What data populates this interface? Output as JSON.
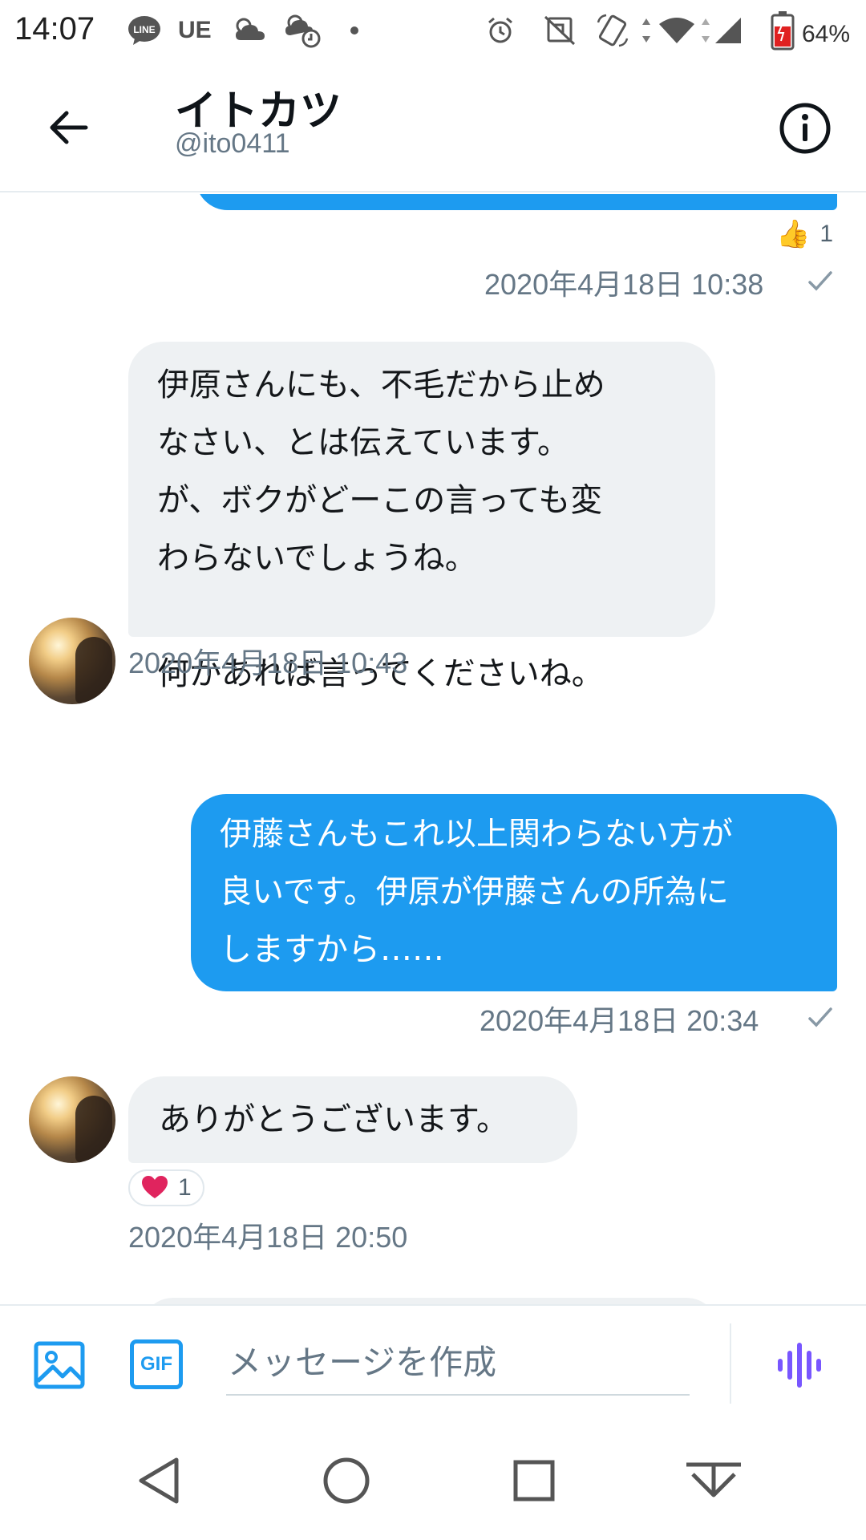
{
  "status_bar": {
    "time": "14:07",
    "notif_ue": "UE",
    "battery_percent": "64%",
    "icons": [
      "line-icon",
      "cloud-icon",
      "cloud-sync-icon",
      "dot-icon",
      "alarm-icon",
      "cast-off-icon",
      "rotate-icon",
      "wifi-icon",
      "signal-icon",
      "battery-icon"
    ]
  },
  "header": {
    "name": "イトカツ",
    "handle": "@ito0411"
  },
  "messages": [
    {
      "direction": "outgoing",
      "text": "",
      "partial": true,
      "reaction": {
        "emoji": "👍",
        "count": "1"
      },
      "timestamp": "2020年4月18日 10:38",
      "read": true
    },
    {
      "direction": "incoming",
      "text": "伊原さんにも、不毛だから止め\nなさい、とは伝えています。\nが、ボクがどーこの言っても変\nわらないでしょうね。\n\n何かあれば言ってくださいね。",
      "timestamp": "2020年4月18日 10:43"
    },
    {
      "direction": "outgoing",
      "text": "伊藤さんもこれ以上関わらない方が\n良いです。伊原が伊藤さんの所為に\nしますから……",
      "timestamp": "2020年4月18日 20:34",
      "read": true
    },
    {
      "direction": "incoming",
      "text": "ありがとうございます。",
      "reaction": {
        "emoji": "❤️",
        "count": "1"
      },
      "timestamp": "2020年4月18日 20:50"
    }
  ],
  "composer": {
    "placeholder": "メッセージを作成",
    "gif_label": "GIF"
  },
  "colors": {
    "accent": "#1d9bf0",
    "incoming_bubble": "#eef1f3",
    "timestamp": "#657786",
    "heart": "#e0245e",
    "voice": "#7856ff"
  }
}
